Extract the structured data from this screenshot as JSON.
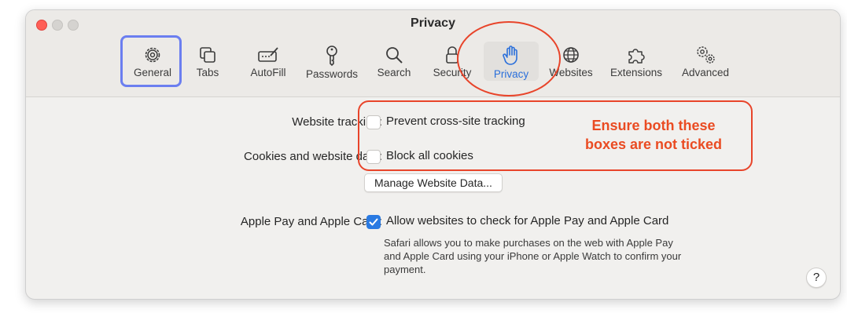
{
  "window": {
    "title": "Privacy"
  },
  "tabs": [
    {
      "label": "General",
      "icon": "gear-icon"
    },
    {
      "label": "Tabs",
      "icon": "tabs-icon"
    },
    {
      "label": "AutoFill",
      "icon": "autofill-icon"
    },
    {
      "label": "Passwords",
      "icon": "key-icon"
    },
    {
      "label": "Search",
      "icon": "search-icon"
    },
    {
      "label": "Security",
      "icon": "lock-icon"
    },
    {
      "label": "Privacy",
      "icon": "hand-icon",
      "active": true
    },
    {
      "label": "Websites",
      "icon": "globe-icon"
    },
    {
      "label": "Extensions",
      "icon": "puzzle-icon"
    },
    {
      "label": "Advanced",
      "icon": "gears-icon"
    }
  ],
  "settings": {
    "tracking_label": "Website tracking:",
    "tracking_option": "Prevent cross-site tracking",
    "tracking_checked": false,
    "cookies_label": "Cookies and website data:",
    "cookies_option": "Block all cookies",
    "cookies_checked": false,
    "manage_button": "Manage Website Data...",
    "applepay_label": "Apple Pay and Apple Card:",
    "applepay_option": "Allow websites to check for Apple Pay and Apple Card",
    "applepay_checked": true,
    "applepay_note_1": "Safari allows you to make purchases on the web with Apple Pay",
    "applepay_note_2": "and Apple Card using your iPhone or Apple Watch to confirm your",
    "applepay_note_3": "payment."
  },
  "help_button": "?",
  "annotation": {
    "line1": "Ensure both these",
    "line2": "boxes are not ticked",
    "color": "#ea4b22",
    "highlight_color": "#6b7ef0"
  },
  "colors": {
    "accent": "#2a6fdb",
    "checkbox_checked": "#2a7ae2"
  }
}
